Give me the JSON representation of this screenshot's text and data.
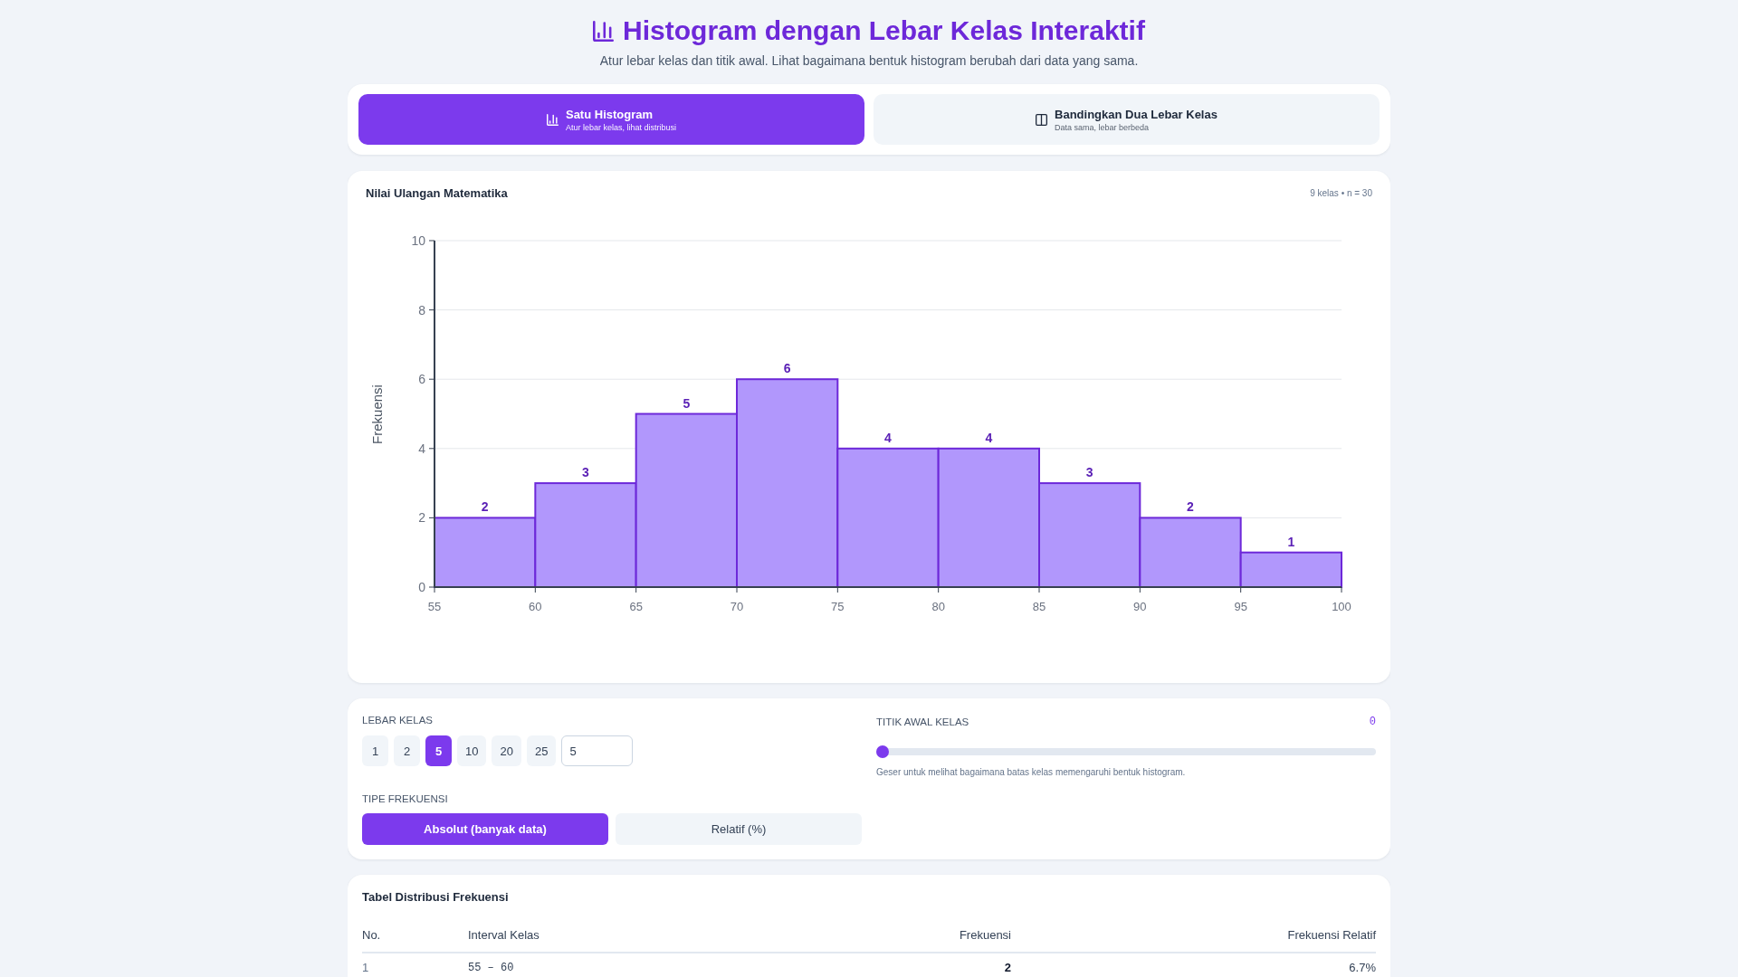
{
  "header": {
    "title": "Histogram dengan Lebar Kelas Interaktif",
    "subtitle": "Atur lebar kelas dan titik awal. Lihat bagaimana bentuk histogram berubah dari data yang sama."
  },
  "tabs": [
    {
      "label": "Satu Histogram",
      "sublabel": "Atur lebar kelas, lihat distribusi",
      "selected": true
    },
    {
      "label": "Bandingkan Dua Lebar Kelas",
      "sublabel": "Data sama, lebar berbeda",
      "selected": false
    }
  ],
  "histogram_card": {
    "summary": "9 kelas • n = 30",
    "chart_data": {
      "type": "bar",
      "title": "Nilai Ulangan Matematika",
      "ylabel": "Frekuensi",
      "x": [
        57.5,
        62.5,
        67.5,
        72.5,
        77.5,
        82.5,
        87.5,
        92.5,
        97.5
      ],
      "values": [
        2,
        3,
        5,
        6,
        4,
        4,
        3,
        2,
        1
      ],
      "xlim": [
        55,
        100
      ],
      "ylim": [
        0,
        10
      ],
      "xticks": [
        55,
        60,
        65,
        70,
        75,
        80,
        85,
        90,
        95,
        100
      ],
      "yticks": [
        0,
        2,
        4,
        6,
        8,
        10
      ],
      "grid": true,
      "data_labels": true
    }
  },
  "controls": {
    "class_width": {
      "label": "LEBAR KELAS",
      "options": [
        {
          "label": "1",
          "selected": false
        },
        {
          "label": "2",
          "selected": false
        },
        {
          "label": "5",
          "selected": true
        },
        {
          "label": "10",
          "selected": false
        },
        {
          "label": "20",
          "selected": false
        },
        {
          "label": "25",
          "selected": false
        }
      ],
      "input": {
        "value": "5"
      }
    },
    "frequency_type": {
      "label": "TIPE FREKUENSI",
      "options": [
        {
          "label": "Absolut (banyak data)",
          "selected": true
        },
        {
          "label": "Relatif (%)",
          "selected": false
        }
      ]
    },
    "start_point": {
      "label": "TITIK AWAL KELAS",
      "value": "0",
      "level": 0,
      "hint": "Geser untuk melihat bagaimana batas kelas memengaruhi bentuk histogram."
    }
  },
  "table": {
    "title": "Tabel Distribusi Frekuensi",
    "columns": [
      "No.",
      "Interval Kelas",
      "Frekuensi",
      "Frekuensi Relatif"
    ],
    "rows": [
      [
        "1",
        "55 – 60",
        "2",
        "6.7%"
      ]
    ]
  }
}
